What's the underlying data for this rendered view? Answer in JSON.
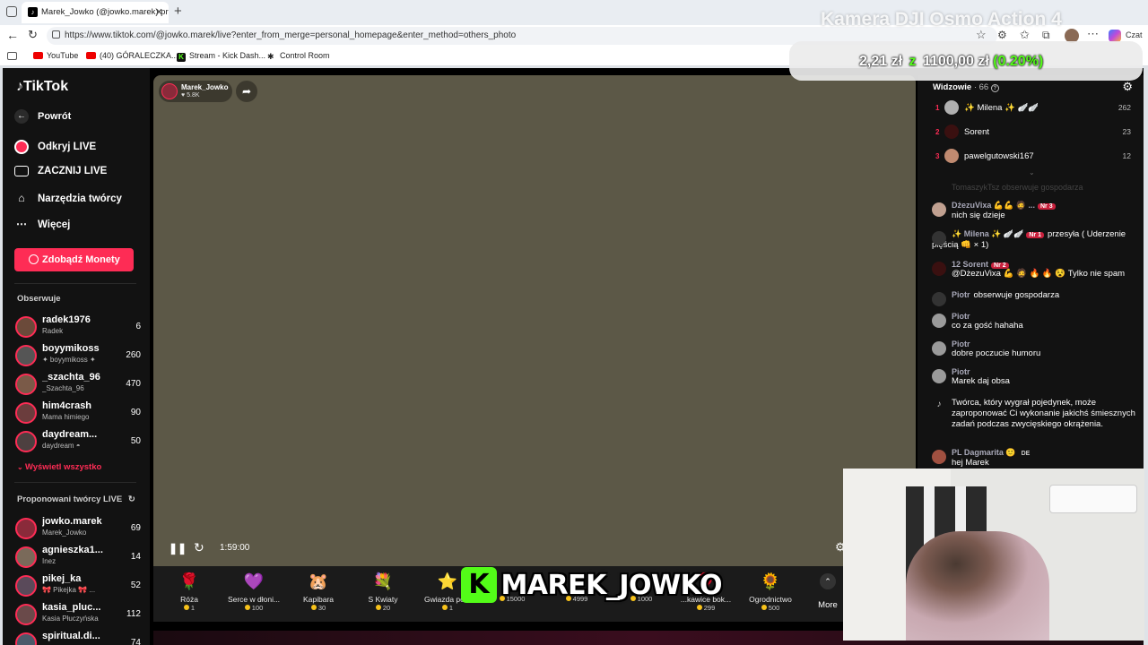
{
  "browser": {
    "tab_title": "Marek_Jowko (@jowko.marek) pro",
    "url": "https://www.tiktok.com/@jowko.marek/live?enter_from_merge=personal_homepage&enter_method=others_photo",
    "chat_label": "Czat",
    "bookmarks": [
      "YouTube",
      "(40) GÓRALECZKA...",
      "Stream - Kick Dash...",
      "Control Room"
    ]
  },
  "overlay": {
    "camera_title": "Kamera DJI Osmo Action 4",
    "ticker_a": "2,21 zł",
    "ticker_sep": "z",
    "ticker_b": "1100,00 zł",
    "ticker_pct": "(0.20%)",
    "kick_name": "MAREK_JOWKO"
  },
  "sidenav": {
    "logo": "TikTok",
    "back": "Powrót",
    "items": [
      "Odkryj LIVE",
      "ZACZNIJ LIVE",
      "Narzędzia twórcy",
      "Więcej"
    ],
    "coins_button": "Zdobądź Monety",
    "following_title": "Obserwuje",
    "following": [
      {
        "name": "radek1976",
        "sub": "Radek",
        "count": "6"
      },
      {
        "name": "boyymikoss",
        "sub": "✦ boyymikoss ✦",
        "count": "260"
      },
      {
        "name": "_szachta_96",
        "sub": "_Szachta_96",
        "count": "470"
      },
      {
        "name": "him4crash",
        "sub": "Mama himiego",
        "count": "90"
      },
      {
        "name": "daydream...",
        "sub": "daydream ◓",
        "count": "50"
      }
    ],
    "show_all": "Wyświetl wszystko",
    "suggested_title": "Proponowani twórcy LIVE",
    "suggested": [
      {
        "name": "jowko.marek",
        "sub": "Marek_Jowko",
        "count": "69"
      },
      {
        "name": "agnieszka1...",
        "sub": "Inez",
        "count": "14"
      },
      {
        "name": "pikej_ka",
        "sub": "🎀 Pikejka 🎀 ...",
        "count": "52"
      },
      {
        "name": "kasia_pluc...",
        "sub": "Kasia Płuczyńska",
        "count": "112"
      },
      {
        "name": "spiritual.di...",
        "sub": "",
        "count": "74"
      }
    ]
  },
  "video": {
    "host_name": "Marek_Jowko",
    "host_likes": "♥ 5.8K",
    "time": "1:59:00"
  },
  "gifts": {
    "items": [
      {
        "name": "Róża",
        "price": "1",
        "icon": "🌹"
      },
      {
        "name": "Serce w dłoni...",
        "price": "100",
        "icon": "💜"
      },
      {
        "name": "Kapibara",
        "price": "30",
        "icon": "🐹"
      },
      {
        "name": "S Kwiaty",
        "price": "20",
        "icon": "💐"
      },
      {
        "name": "Gwiazda po...",
        "price": "1",
        "icon": "⭐"
      },
      {
        "name": "",
        "price": "15000",
        "icon": ""
      },
      {
        "name": "",
        "price": "4999",
        "icon": ""
      },
      {
        "name": "",
        "price": "1000",
        "icon": ""
      },
      {
        "name": "...kawice bok...",
        "price": "299",
        "icon": "🥊"
      },
      {
        "name": "Ogrodnictwo",
        "price": "500",
        "icon": "🌻"
      }
    ],
    "more": "More"
  },
  "chat": {
    "viewers_label": "Widzowie",
    "viewers_count": "· 66",
    "top": [
      {
        "rank": "1",
        "name": "✨ Milena ✨ 🪽🪽",
        "score": "262"
      },
      {
        "rank": "2",
        "name": "Sorent",
        "score": "23"
      },
      {
        "rank": "3",
        "name": "pawelgutowski167",
        "score": "12"
      }
    ],
    "faded_line": "TomaszykTsz  obserwuje gospodarza",
    "messages": [
      {
        "user": "DżezuVixa 💪💪 🧔 ...",
        "badge": "Nr 3",
        "text": "nich się dzieje"
      },
      {
        "user": "✨ Milena ✨ 🪽🪽",
        "badge": "Nr 1",
        "text": "przesyła ( Uderzenie pięścią 👊 × 1)"
      },
      {
        "user": "12  Sorent",
        "badge": "Nr 2",
        "text": "@DżezuVixa 💪 🧔 🔥 🔥 😵 Tylko nie spam"
      },
      {
        "user": "Piotr",
        "badge": "",
        "text": "obserwuje gospodarza"
      },
      {
        "user": "Piotr",
        "badge": "",
        "text": "co za gość hahaha"
      },
      {
        "user": "Piotr",
        "badge": "",
        "text": "dobre poczucie humoru"
      },
      {
        "user": "Piotr",
        "badge": "",
        "text": "Marek daj obsa"
      },
      {
        "user": "",
        "badge": "",
        "text": "Twórca, który wygrał pojedynek, może zaproponować Ci wykonanie jakichś śmiesznych zadań podczas zwycięskiego okrążenia."
      },
      {
        "user": "PL Dagmarita 🙂",
        "badge": "DE",
        "text": "hej Marek"
      }
    ]
  }
}
